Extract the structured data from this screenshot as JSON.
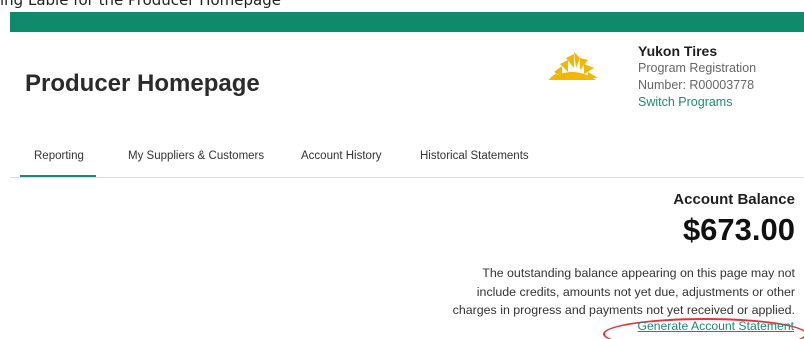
{
  "caption": "ing Lable for the Producer Homepage",
  "header": {
    "page_title": "Producer Homepage"
  },
  "account": {
    "company_name": "Yukon Tires",
    "registration_line1": "Program Registration",
    "registration_line2": "Number: R00003778",
    "switch_programs_label": "Switch Programs"
  },
  "tabs": [
    {
      "label": "Reporting",
      "active": true
    },
    {
      "label": "My Suppliers & Customers",
      "active": false
    },
    {
      "label": "Account History",
      "active": false
    },
    {
      "label": "Historical Statements",
      "active": false
    }
  ],
  "balance": {
    "label": "Account Balance",
    "amount": "$673.00",
    "notice_line1": "The outstanding balance appearing on this page may not",
    "notice_line2": "include credits, amounts not yet due, adjustments or other",
    "notice_line3": "charges in progress and payments not yet received or applied.",
    "generate_statement_label": "Generate Account Statement"
  },
  "colors": {
    "brand_green": "#0f8a6b",
    "link_teal": "#1c8a76",
    "logo_yellow": "#f2b705",
    "annotation_red": "#e0343f"
  }
}
